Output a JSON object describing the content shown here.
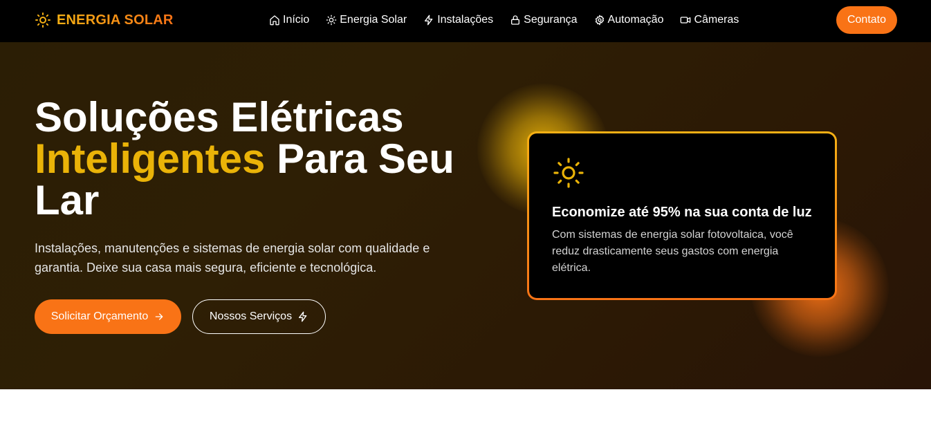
{
  "brand": {
    "name": "ENERGIA SOLAR",
    "icon": "sun-icon"
  },
  "nav": {
    "items": [
      {
        "label": "Início",
        "icon": "home-icon"
      },
      {
        "label": "Energia Solar",
        "icon": "sun-icon"
      },
      {
        "label": "Instalações",
        "icon": "bolt-icon"
      },
      {
        "label": "Segurança",
        "icon": "lock-icon"
      },
      {
        "label": "Automação",
        "icon": "gear-icon"
      },
      {
        "label": "Câmeras",
        "icon": "video-icon"
      }
    ],
    "contact_label": "Contato"
  },
  "hero": {
    "title_part1": "Soluções Elétricas",
    "title_accent": "Inteligentes",
    "title_part2": "Para Seu Lar",
    "subtitle": "Instalações, manutenções e sistemas de energia solar com qualidade e garantia. Deixe sua casa mais segura, eficiente e tecnológica.",
    "primary_button": "Solicitar Orçamento",
    "secondary_button": "Nossos Serviços"
  },
  "card": {
    "icon": "sun-icon",
    "title": "Economize até 95% na sua conta de luz",
    "text": "Com sistemas de energia solar fotovoltaica, você reduz drasticamente seus gastos com energia elétrica."
  },
  "colors": {
    "accent_yellow": "#eab308",
    "accent_orange": "#f97316",
    "nav_background": "#000000",
    "hero_background": "#2c1d05"
  }
}
